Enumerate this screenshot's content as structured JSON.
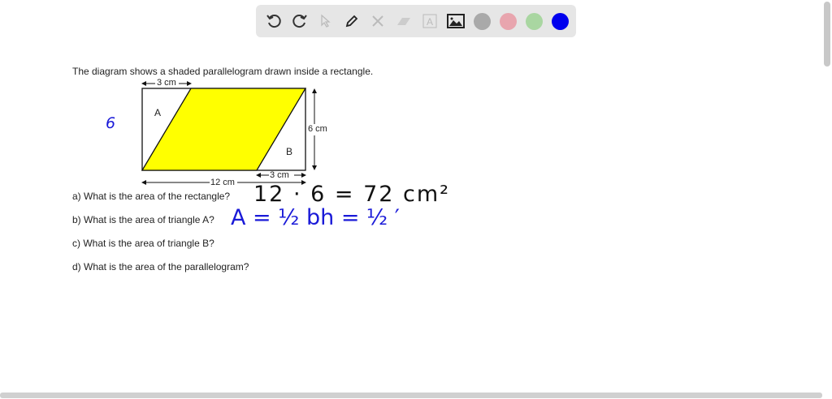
{
  "toolbar": {
    "tools": [
      "undo",
      "redo",
      "select",
      "pen",
      "tools",
      "eraser",
      "text",
      "image"
    ],
    "colors": [
      "#a9a9a9",
      "#e8a5ae",
      "#a9d6a1",
      "#0000ee"
    ]
  },
  "problem": {
    "intro": "The diagram shows a shaded parallelogram drawn inside a rectangle.",
    "diagram": {
      "top_dim": "3 cm",
      "right_dim": "6 cm",
      "bottom_right_dim": "3 cm",
      "bottom_dim": "12 cm",
      "label_a": "A",
      "label_b": "B",
      "fill": "#ffff00"
    },
    "questions": [
      "a)  What is the area of the rectangle?",
      "b)  What is the area of triangle A?",
      "c)  What is the area of triangle B?",
      "d)  What is the area of the parallelogram?"
    ]
  },
  "handwriting": {
    "side_note": "6",
    "answer_a": "12 · 6 = 72 cm²",
    "answer_b": "A = ½ bh = ½ ′"
  }
}
